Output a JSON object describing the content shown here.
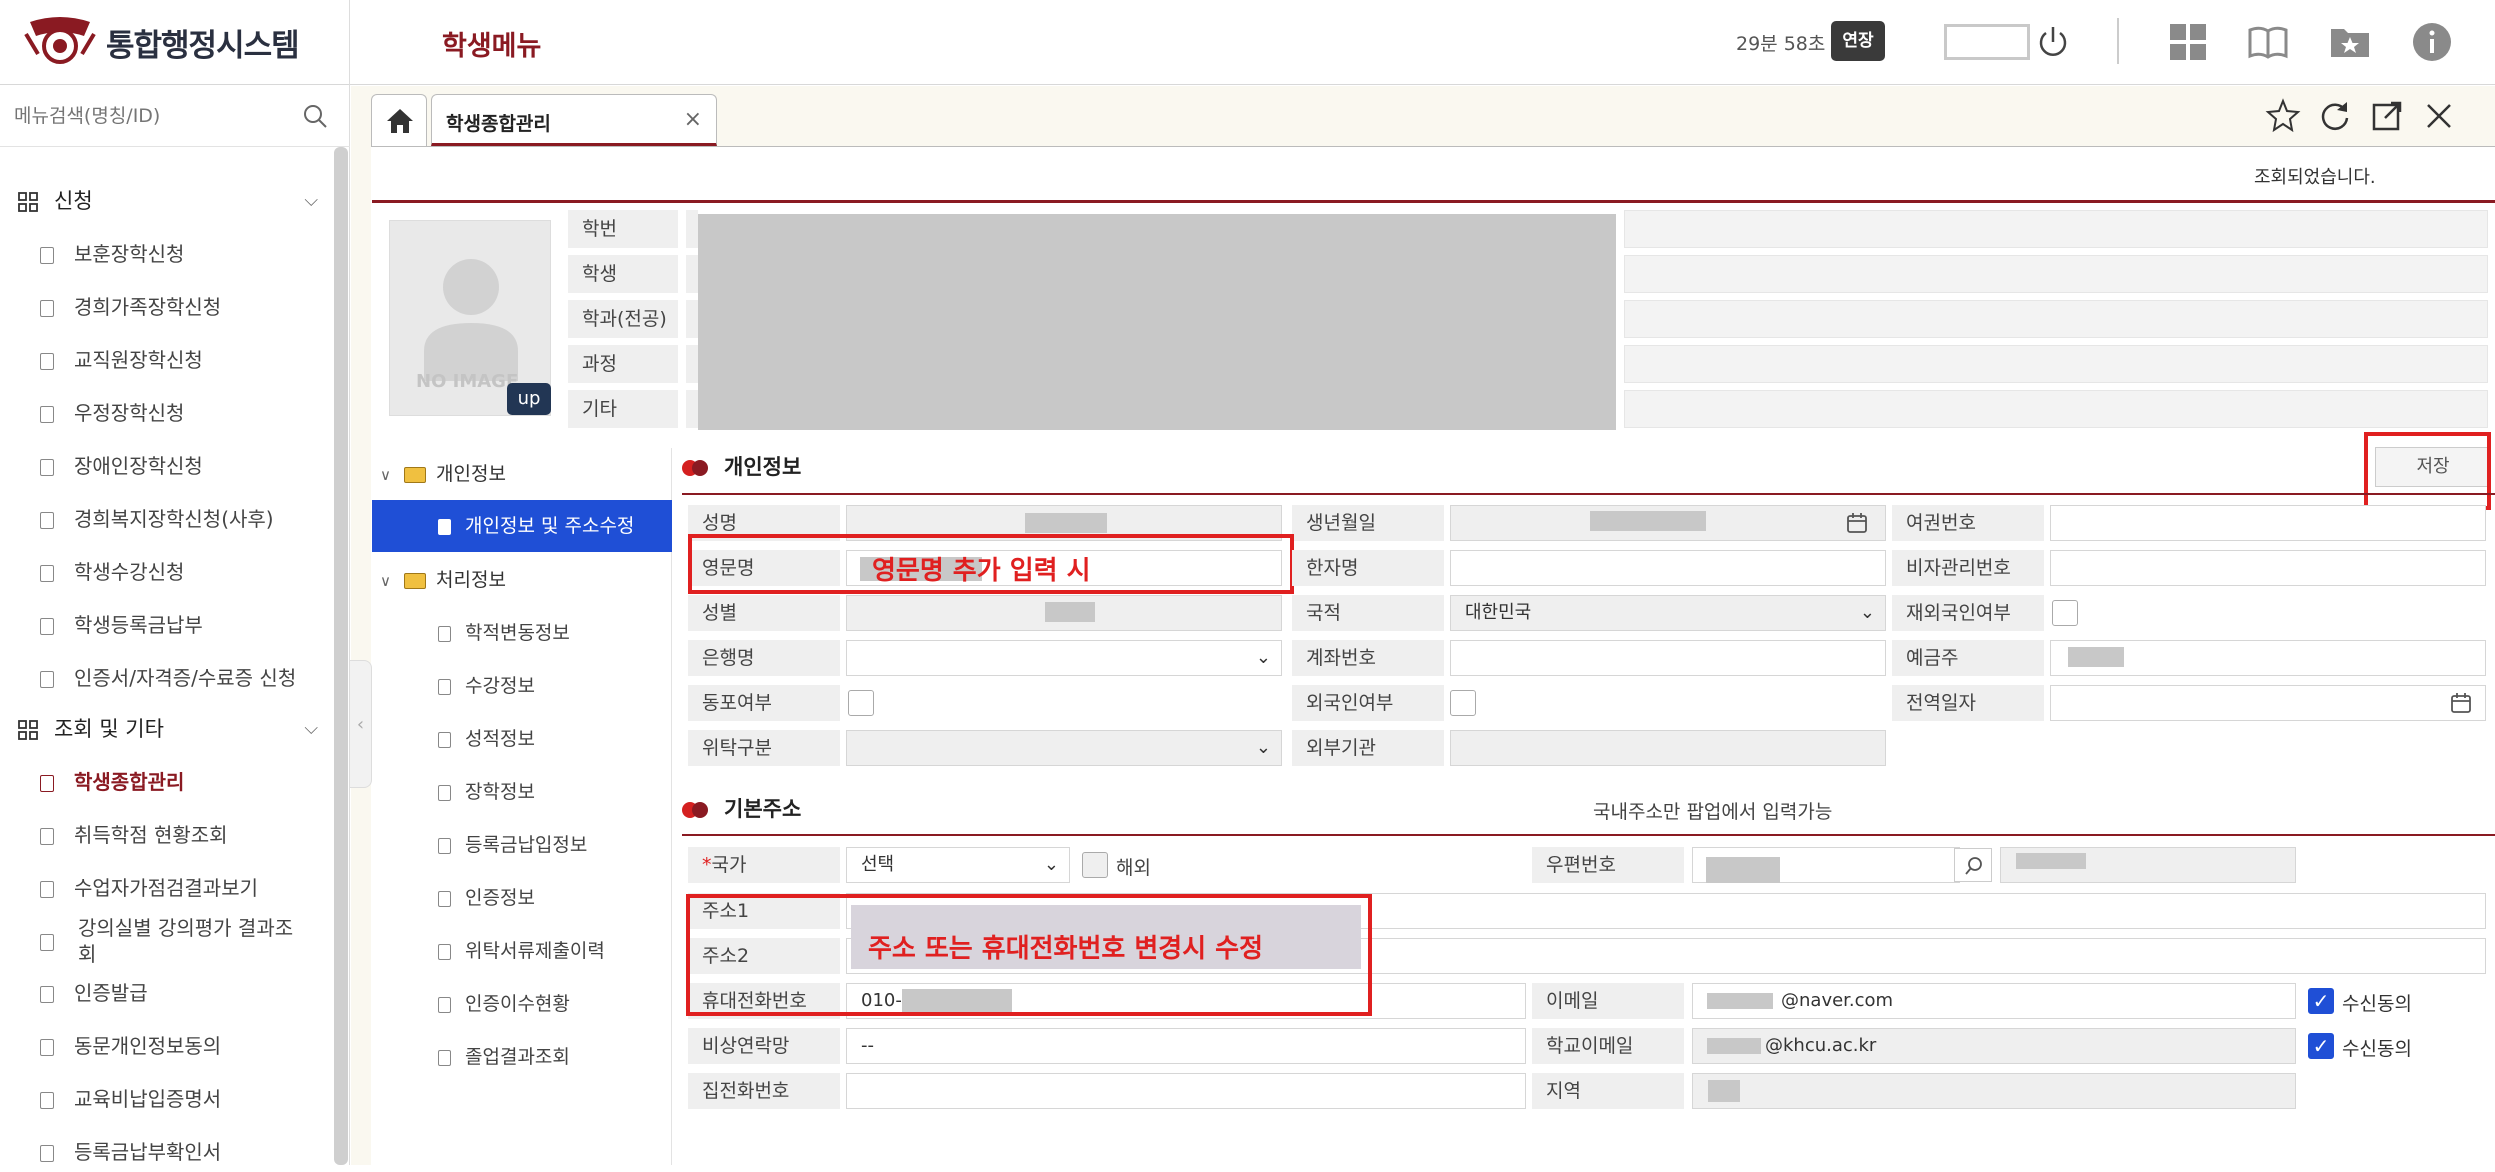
{
  "app": {
    "title": "통합행정시스템",
    "menu_title": "학생메뉴",
    "session_time": "29분 58초",
    "extend_label": "연장"
  },
  "colors": {
    "brand": "#8a1a22",
    "active_blue": "#1f4fd6",
    "annotation_red": "#e02020"
  },
  "sidebar": {
    "search_placeholder": "메뉴검색(명칭/ID)",
    "sections": [
      {
        "title": "신청",
        "items": [
          "보훈장학신청",
          "경희가족장학신청",
          "교직원장학신청",
          "우정장학신청",
          "장애인장학신청",
          "경희복지장학신청(사후)",
          "학생수강신청",
          "학생등록금납부",
          "인증서/자격증/수료증 신청"
        ]
      },
      {
        "title": "조회 및 기타",
        "items": [
          "학생종합관리",
          "취득학점 현황조회",
          "수업자가점검결과보기",
          "강의실별 강의평가 결과조회",
          "인증발급",
          "동문개인정보동의",
          "교육비납입증명서",
          "등록금납부확인서"
        ]
      }
    ],
    "active_item": "학생종합관리",
    "multiline_item": [
      "강의실별 강의평가 결과조",
      "회"
    ]
  },
  "tabs": {
    "home_icon": "home-icon",
    "active_tab": "학생종합관리"
  },
  "status_message": "조회되었습니다.",
  "profile": {
    "photo_text": "NO IMAGE",
    "upload_label": "up",
    "labels": [
      "학번",
      "학생",
      "학과(전공)",
      "과정",
      "기타"
    ]
  },
  "tree": {
    "folders": [
      {
        "label": "개인정보",
        "items": [
          "개인정보 및 주소수정"
        ]
      },
      {
        "label": "처리정보",
        "items": [
          "학적변동정보",
          "수강정보",
          "성적정보",
          "장학정보",
          "등록금납입정보",
          "인증정보",
          "위탁서류제출이력",
          "인증이수현황",
          "졸업결과조회"
        ]
      }
    ]
  },
  "personal": {
    "title": "개인정보",
    "save_label": "저장",
    "labels": {
      "name": "성명",
      "eng_name": "영문명",
      "gender": "성별",
      "bank": "은행명",
      "overseas_korean": "동포여부",
      "consign": "위탁구분",
      "birth": "생년월일",
      "hanja": "한자명",
      "nationality": "국적",
      "account": "계좌번호",
      "foreigner": "외국인여부",
      "ext_org": "외부기관",
      "passport": "여권번호",
      "visa": "비자관리번호",
      "abroad": "재외국인여부",
      "depositor": "예금주",
      "discharge": "전역일자"
    },
    "nationality_value": "대한민국",
    "annotation": "영문명 추가 입력 시"
  },
  "address": {
    "title": "기본주소",
    "note": "국내주소만 팝업에서 입력가능",
    "labels": {
      "country": "국가",
      "addr1": "주소1",
      "addr2": "주소2",
      "mobile": "휴대전화번호",
      "emergency": "비상연락망",
      "home_phone": "집전화번호",
      "zip": "우편번호",
      "email": "이메일",
      "school_email": "학교이메일",
      "region": "지역"
    },
    "required_mark": "*",
    "country_value": "선택",
    "overseas_label": "해외",
    "mobile_prefix": "010-",
    "emergency_value": "--",
    "email_domain": "@naver.com",
    "school_email_domain": "@khcu.ac.kr",
    "consent_label": "수신동의",
    "annotation": "주소 또는 휴대전화번호 변경시 수정"
  }
}
